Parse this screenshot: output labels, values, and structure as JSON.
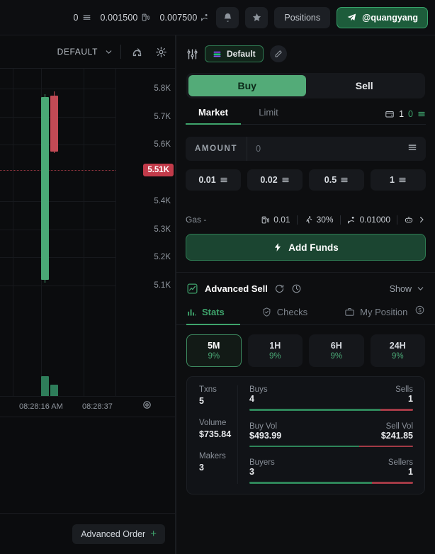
{
  "topbar": {
    "metrics": [
      {
        "icon": "stack-icon",
        "value": "0",
        "icon_pos": "right"
      },
      {
        "icon": "gas-pump-icon",
        "value": "0.001500",
        "icon_pos": "right"
      },
      {
        "icon": "tip-icon",
        "value": "0.007500",
        "icon_pos": "right"
      }
    ],
    "bell_icon": "bell-icon",
    "star_icon": "star-icon",
    "positions_label": "Positions",
    "user_label": "@quangyang",
    "user_icon": "telegram-icon"
  },
  "chart": {
    "preset_label": "DEFAULT",
    "chevron_icon": "chevron-down-icon",
    "magnet_icon": "magnet-icon",
    "gear_icon": "gear-icon",
    "target_icon": "target-icon",
    "advanced_order_label": "Advanced Order",
    "advanced_order_plus": "+"
  },
  "chart_data": {
    "type": "candlestick",
    "title": "",
    "xlabel": "",
    "ylabel": "",
    "y_ticks": [
      "5.8K",
      "5.7K",
      "5.6K",
      "5.4K",
      "5.3K",
      "5.2K",
      "5.1K"
    ],
    "x_ticks": [
      "08:28:16 AM",
      "08:28:37"
    ],
    "current_price_label": "5.51K",
    "current_price_color": "#c23b4a",
    "ylim": [
      5050,
      5870
    ],
    "grid": true,
    "candles": [
      {
        "time": "08:28:16 AM",
        "open": 5120,
        "high": 5780,
        "low": 5110,
        "close": 5770,
        "direction": "up",
        "color": "#4aa876"
      },
      {
        "time": "08:28:37",
        "open": 5775,
        "high": 5790,
        "low": 5570,
        "close": 5575,
        "direction": "down",
        "color": "#c24a55"
      }
    ],
    "volume": [
      {
        "time": "08:28:16 AM",
        "value": 493.99,
        "direction": "up",
        "color": "#2e7d5a"
      },
      {
        "time": "08:28:37",
        "value": 241.85,
        "direction": "up",
        "color": "#2e7d5a"
      }
    ]
  },
  "trade": {
    "settings_icon": "sliders-icon",
    "preset_chip_label": "Default",
    "preset_chip_icon": "solana-stack-icon",
    "edit_icon": "pencil-icon",
    "buy_label": "Buy",
    "sell_label": "Sell",
    "active_side": "Buy",
    "order_tabs": [
      {
        "label": "Market",
        "active": true
      },
      {
        "label": "Limit",
        "active": false
      }
    ],
    "wallet": {
      "icon": "wallet-icon",
      "count": "1",
      "balance": "0",
      "balance_icon": "stack-icon"
    },
    "amount_label": "AMOUNT",
    "amount_value": "",
    "amount_placeholder": "0",
    "amount_unit_icon": "stack-icon",
    "presets": [
      {
        "value": "0.01",
        "icon": "stack-icon"
      },
      {
        "value": "0.02",
        "icon": "stack-icon"
      },
      {
        "value": "0.5",
        "icon": "stack-icon"
      },
      {
        "value": "1",
        "icon": "stack-icon"
      }
    ],
    "gas_label": "Gas -",
    "gas_items": [
      {
        "icon": "gas-pump-icon",
        "value": "0.01"
      },
      {
        "icon": "runner-icon",
        "value": "30%"
      },
      {
        "icon": "tip-icon",
        "value": "0.01000"
      }
    ],
    "gas_robot_icon": "robot-icon",
    "gas_chevron_icon": "chevron-right-icon",
    "add_funds_label": "Add Funds",
    "add_funds_icon": "lightning-icon"
  },
  "advanced_sell": {
    "chart_icon": "line-chart-icon",
    "title": "Advanced Sell",
    "refresh_icon": "refresh-icon",
    "speed_icon": "speedometer-icon",
    "show_label": "Show",
    "show_chevron_icon": "chevron-down-icon"
  },
  "stats": {
    "tabs": [
      {
        "label": "Stats",
        "icon": "bar-chart-icon",
        "active": true
      },
      {
        "label": "Checks",
        "icon": "shield-check-icon",
        "active": false
      },
      {
        "label": "My Position",
        "icon": "briefcase-icon",
        "active": false
      }
    ],
    "refresh_icon": "refresh-circle-icon",
    "timeframes": [
      {
        "name": "5M",
        "pct": "9%",
        "active": true
      },
      {
        "name": "1H",
        "pct": "9%",
        "active": false
      },
      {
        "name": "6H",
        "pct": "9%",
        "active": false
      },
      {
        "name": "24H",
        "pct": "9%",
        "active": false
      }
    ],
    "summary": [
      {
        "label": "Txns",
        "value": "5"
      },
      {
        "label": "Volume",
        "value": "$735.84"
      },
      {
        "label": "Makers",
        "value": "3"
      }
    ],
    "groups": [
      {
        "left_label": "Buys",
        "left_value": "4",
        "right_label": "Sells",
        "right_value": "1",
        "buy_pct": 80,
        "sell_pct": 20
      },
      {
        "left_label": "Buy Vol",
        "left_value": "$493.99",
        "right_label": "Sell Vol",
        "right_value": "$241.85",
        "buy_pct": 67,
        "sell_pct": 33
      },
      {
        "left_label": "Buyers",
        "left_value": "3",
        "right_label": "Sellers",
        "right_value": "1",
        "buy_pct": 75,
        "sell_pct": 25
      }
    ]
  },
  "colors": {
    "accent_green": "#3ea46c",
    "buy_green": "#53ab78",
    "sell_red": "#c23b4a",
    "bg": "#0b0c0e"
  }
}
